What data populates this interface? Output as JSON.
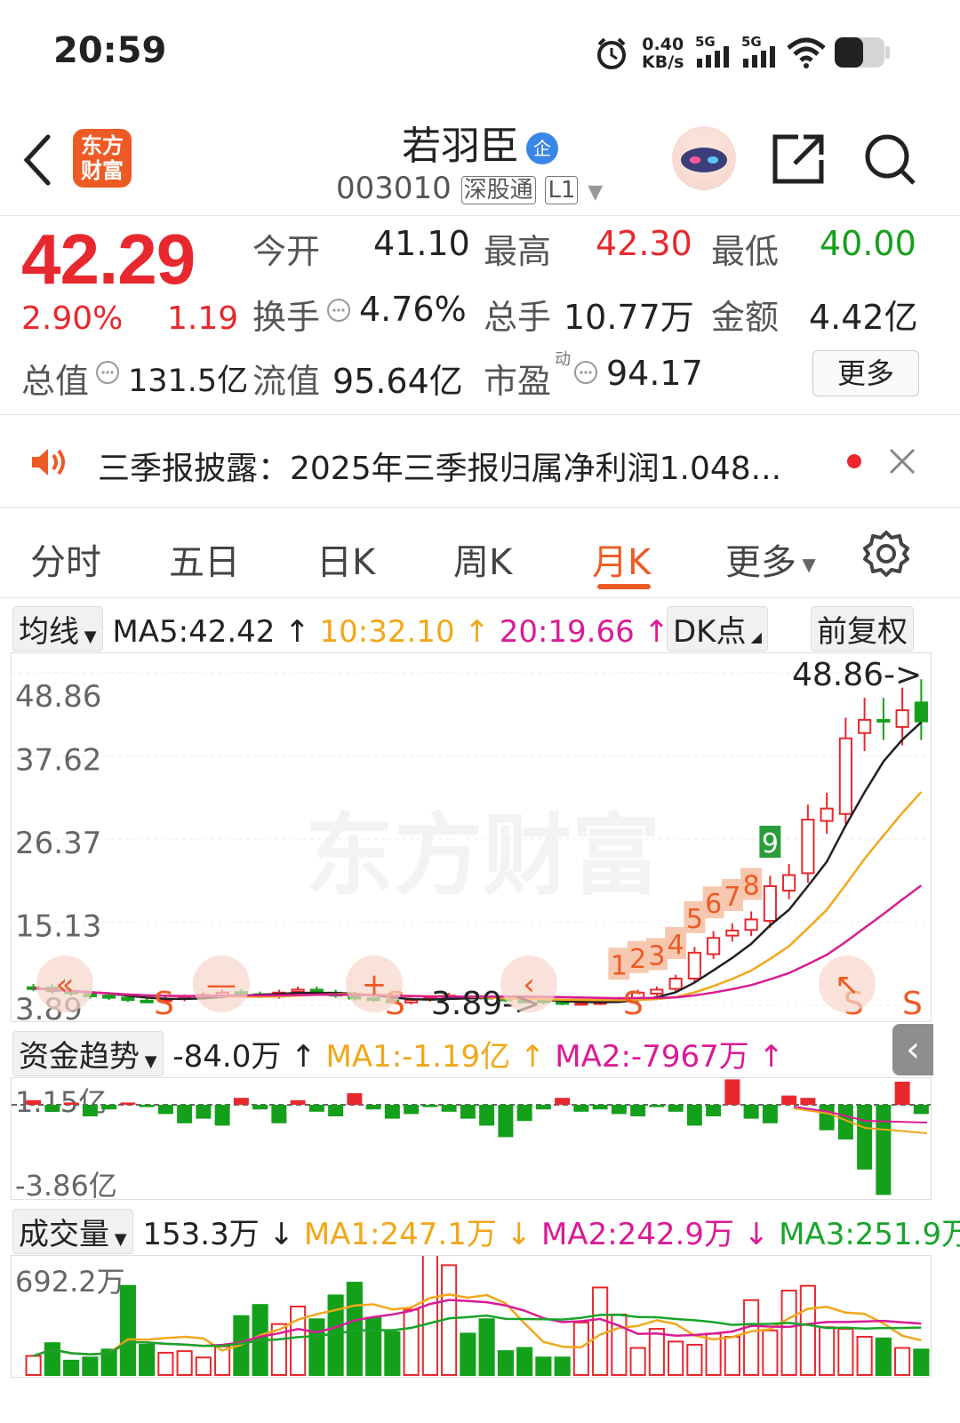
{
  "status_bar": {
    "time": "20:59",
    "net_speed_value": "0.40",
    "net_speed_unit": "KB/s",
    "signal1": "5G",
    "signal2": "5G"
  },
  "header": {
    "logo_text_line1": "东方",
    "logo_text_line2": "财富",
    "stock_name": "若羽臣",
    "enterprise_badge": "企",
    "stock_code": "003010",
    "tag_connect": "深股通",
    "tag_level": "L1"
  },
  "quote": {
    "price": "42.29",
    "change_pct": "2.90%",
    "change_amt": "1.19",
    "open_label": "今开",
    "open": "41.10",
    "high_label": "最高",
    "high": "42.30",
    "low_label": "最低",
    "low": "40.00",
    "turnover_label": "换手",
    "turnover": "4.76%",
    "volume_label": "总手",
    "volume": "10.77万",
    "amount_label": "金额",
    "amount": "4.42亿",
    "mktcap_label": "总值",
    "mktcap": "131.5亿",
    "float_label": "流值",
    "float_cap": "95.64亿",
    "pe_label": "市盈",
    "pe_sup": "动",
    "pe": "94.17",
    "more_label": "更多"
  },
  "news": {
    "text": "三季报披露：2025年三季报归属净利润1.048..."
  },
  "tabs": [
    "分时",
    "五日",
    "日K",
    "周K",
    "月K",
    "更多"
  ],
  "active_tab": "月K",
  "kline": {
    "ma_selector": "均线",
    "ma5": "MA5:42.42",
    "ma10": "10:32.10",
    "ma20": "20:19.66",
    "dk_label": "DK点",
    "fq_label": "前复权",
    "watermark": "东方财富",
    "y_labels": [
      "48.86",
      "37.62",
      "26.37",
      "15.13",
      "3.89"
    ],
    "high_marker": "48.86->",
    "low_marker": "3.89->",
    "td_numbers": [
      "1",
      "2",
      "3",
      "4",
      "5",
      "6",
      "7",
      "8",
      "9"
    ],
    "sell_marks": [
      "S",
      "S",
      "S",
      "S",
      "S"
    ]
  },
  "fund_flow": {
    "selector": "资金趋势",
    "value": "-84.0万",
    "ma1": "MA1:-1.19亿",
    "ma2": "MA2:-7967万",
    "y_top": "1.15亿",
    "y_bottom": "-3.86亿"
  },
  "volume_panel": {
    "selector": "成交量",
    "value": "153.3万",
    "ma1": "MA1:247.1万",
    "ma2": "MA2:242.9万",
    "ma3": "MA3:251.9万",
    "y_top": "692.2万"
  },
  "colors": {
    "up": "#e8282e",
    "down": "#15a01b",
    "accent": "#ee5a24",
    "ma_yellow": "#f1a71a",
    "ma_magenta": "#d91b95"
  },
  "chart_data": [
    {
      "type": "candlestick",
      "title": "月K",
      "ylim": [
        3.89,
        48.86
      ],
      "series": [
        {
          "name": "MA5",
          "last": 42.42
        },
        {
          "name": "MA10",
          "last": 32.1
        },
        {
          "name": "MA20",
          "last": 19.66
        }
      ],
      "close": [
        6.2,
        5.8,
        5.5,
        5.1,
        4.9,
        4.6,
        4.5,
        4.7,
        5.0,
        5.3,
        5.6,
        5.4,
        5.2,
        5.6,
        6.0,
        5.7,
        5.2,
        4.8,
        4.6,
        4.4,
        4.6,
        4.9,
        5.2,
        5.0,
        4.8,
        4.6,
        4.5,
        4.3,
        4.1,
        4.2,
        4.4,
        4.7,
        5.6,
        6.0,
        7.5,
        11.0,
        13.0,
        14.0,
        15.5,
        20.0,
        21.5,
        29.0,
        30.5,
        40.0,
        42.5,
        42.3,
        43.8,
        42.29
      ]
    },
    {
      "type": "bar",
      "title": "资金趋势",
      "ylim": [
        -3.86,
        1.15
      ]
    },
    {
      "type": "bar",
      "title": "成交量",
      "ylim": [
        0,
        692.2
      ]
    }
  ]
}
